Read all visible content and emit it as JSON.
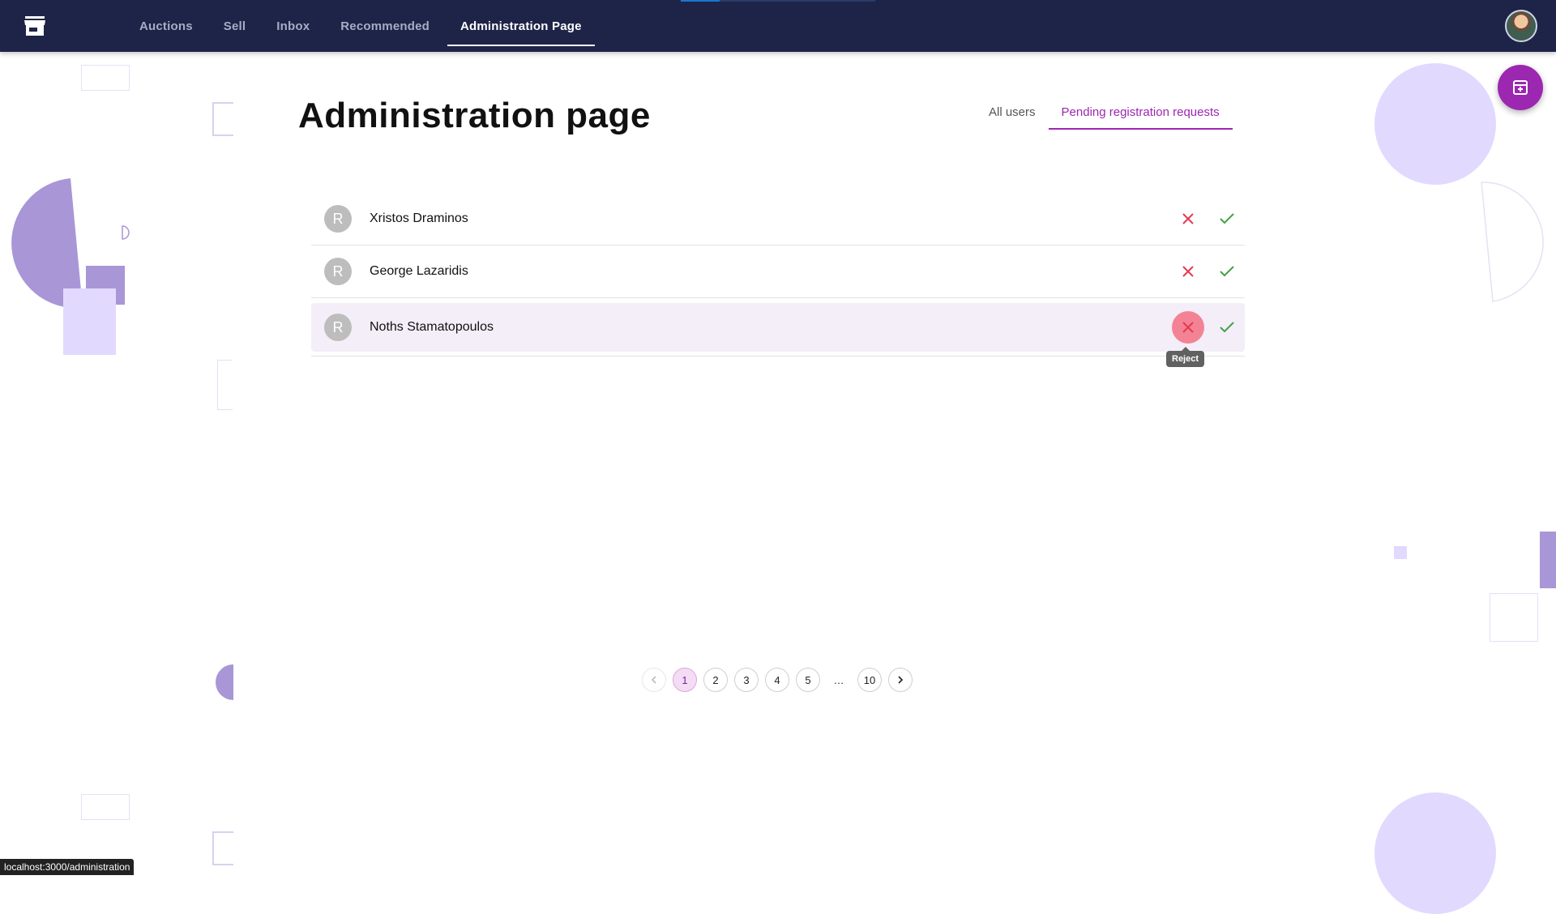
{
  "header": {
    "nav": [
      {
        "label": "Auctions",
        "active": false
      },
      {
        "label": "Sell",
        "active": false
      },
      {
        "label": "Inbox",
        "active": false
      },
      {
        "label": "Recommended",
        "active": false
      },
      {
        "label": "Administration Page",
        "active": true
      }
    ]
  },
  "page": {
    "title": "Administration page",
    "tabs": [
      {
        "label": "All users",
        "active": false
      },
      {
        "label": "Pending registration requests",
        "active": true
      }
    ]
  },
  "requests": [
    {
      "initial": "R",
      "name": "Xristos Draminos"
    },
    {
      "initial": "R",
      "name": "George Lazaridis"
    },
    {
      "initial": "R",
      "name": "Noths Stamatopoulos"
    }
  ],
  "tooltip": {
    "text": "Reject"
  },
  "pagination": {
    "pages": [
      "1",
      "2",
      "3",
      "4",
      "5"
    ],
    "ellipsis": "…",
    "last": "10",
    "current": "1"
  },
  "status_url": "localhost:3000/administration",
  "colors": {
    "appbar": "#1e2448",
    "accent": "#9c27b0",
    "reject": "#e53950",
    "accept": "#43a047",
    "decoration": "#a996d6"
  },
  "icons": {
    "logo": "storefront-icon",
    "fab": "add-box-icon",
    "reject": "close-icon",
    "accept": "check-icon",
    "prev": "chevron-left-icon",
    "next": "chevron-right-icon"
  }
}
